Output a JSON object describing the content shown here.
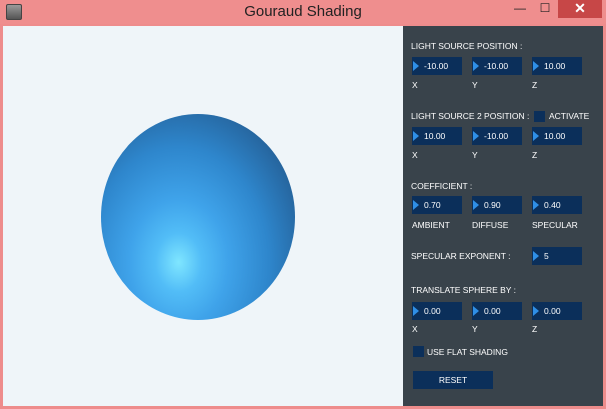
{
  "window": {
    "title": "Gouraud Shading",
    "controls": {
      "minimize": "—",
      "maximize": "☐",
      "close": "✕"
    },
    "colors": {
      "titlebar": "#ef8e8e",
      "close": "#c74747",
      "panel": "#39434b",
      "field": "#0b2f5a",
      "canvas": "#eff5f9",
      "sphere": "#3fa3ea"
    }
  },
  "light1": {
    "heading": "LIGHT SOURCE POSITION :",
    "x": "-10.00",
    "y": "-10.00",
    "z": "10.00",
    "x_label": "X",
    "y_label": "Y",
    "z_label": "Z"
  },
  "light2": {
    "heading": "LIGHT SOURCE 2 POSITION :",
    "activate_label": "ACTIVATE",
    "x": "10.00",
    "y": "-10.00",
    "z": "10.00",
    "x_label": "X",
    "y_label": "Y",
    "z_label": "Z"
  },
  "coeff": {
    "heading": "COEFFICIENT :",
    "ambient": "0.70",
    "diffuse": "0.90",
    "specular": "0.40",
    "ambient_label": "AMBIENT",
    "diffuse_label": "DIFFUSE",
    "specular_label": "SPECULAR"
  },
  "specular_exponent": {
    "label": "SPECULAR EXPONENT :",
    "value": "5"
  },
  "translate": {
    "heading": "TRANSLATE SPHERE BY :",
    "x": "0.00",
    "y": "0.00",
    "z": "0.00",
    "x_label": "X",
    "y_label": "Y",
    "z_label": "Z"
  },
  "flat_shading_label": "USE FLAT SHADING",
  "reset_label": "RESET"
}
